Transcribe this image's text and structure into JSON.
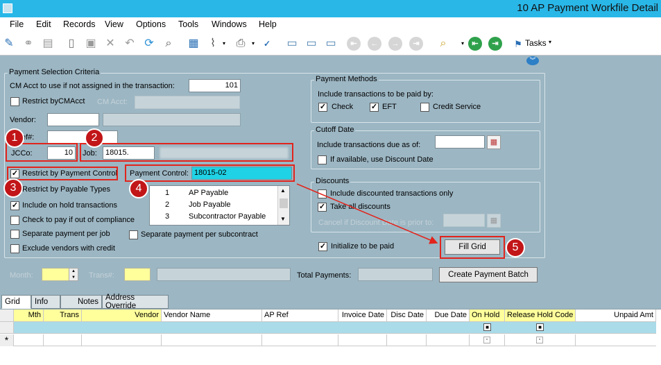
{
  "window": {
    "title": "10 AP Payment Workfile Detail"
  },
  "menu": [
    "File",
    "Edit",
    "Records",
    "View",
    "Options",
    "Tools",
    "Windows",
    "Help"
  ],
  "toolbar": {
    "tasks_label": "Tasks"
  },
  "criteria": {
    "group_title": "Payment Selection Criteria",
    "cm_acct_label": "CM Acct to use if not assigned in the transaction:",
    "cm_acct_value": "101",
    "restrict_cmacct_label": "Restrict byCMAcct",
    "cm_acct_small_label": "CM Acct:",
    "vendor_label": "Vendor:",
    "ref_label": "ef#:",
    "jcco_label": "JCCo:",
    "jcco_value": "10",
    "job_label": "Job:",
    "job_value": "18015.",
    "restrict_payment_control_label": "Restrict by Payment Control",
    "restrict_payable_types_label": "Restrict by Payable Types",
    "include_on_hold_label": "Include on hold transactions",
    "check_pay_compliance_label": "Check to pay if out of compliance",
    "separate_job_label": "Separate payment per job",
    "separate_subcontract_label": "Separate payment per subcontract",
    "exclude_vendors_label": "Exclude vendors with credit",
    "payment_control_label": "Payment Control:",
    "payment_control_value": "18015-02",
    "payable_types": [
      {
        "num": "1",
        "name": "AP Payable"
      },
      {
        "num": "2",
        "name": "Job Payable"
      },
      {
        "num": "3",
        "name": "Subcontractor Payable"
      }
    ]
  },
  "payment_methods": {
    "group_title": "Payment Methods",
    "prompt": "Include transactions to be paid by:",
    "check_label": "Check",
    "eft_label": "EFT",
    "credit_service_label": "Credit Service"
  },
  "cutoff": {
    "group_title": "Cutoff Date",
    "include_due_label": "Include transactions due as of:",
    "discount_date_label": "If available, use Discount Date"
  },
  "discounts": {
    "group_title": "Discounts",
    "include_discounted_label": "Include discounted transactions only",
    "take_all_label": "Take all discounts",
    "cancel_label": "Cancel if Discount Date is prior to:"
  },
  "initialize_label": "Initialize to be paid",
  "fill_grid_label": "Fill Grid",
  "bottom": {
    "month_label": "Month:",
    "trans_label": "Trans#:",
    "total_payments_label": "Total Payments:",
    "create_batch_label": "Create Payment Batch"
  },
  "tabs": [
    "Grid",
    "Info",
    "Notes",
    "Address Override"
  ],
  "grid": {
    "columns": [
      "Mth",
      "Trans",
      "Vendor",
      "Vendor Name",
      "AP Ref",
      "Invoice Date",
      "Disc Date",
      "Due Date",
      "On Hold",
      "Release Hold Code",
      "Unpaid Amt"
    ],
    "new_row_marker": "*"
  },
  "annotations": [
    "1",
    "2",
    "3",
    "4",
    "5"
  ],
  "colors": {
    "titlebar": "#29b7e8",
    "form_bg": "#9cb6c3",
    "highlight": "#e2241c",
    "badge": "#c21518",
    "field_cyan": "#1fd2e5",
    "field_yellow": "#ffff9c"
  }
}
